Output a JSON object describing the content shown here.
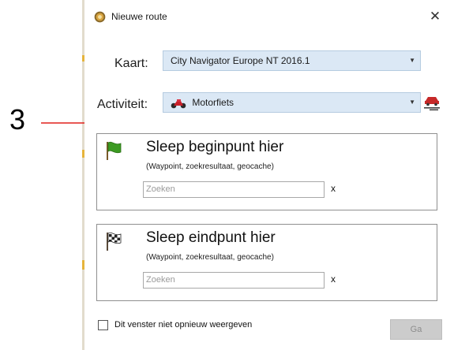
{
  "callout": {
    "number": "3",
    "arrow_color": "#e0201c"
  },
  "dialog": {
    "title": "Nieuwe route",
    "close_glyph": "✕",
    "map_label": "Kaart:",
    "map_value": "City Navigator Europe NT 2016.1",
    "activity_label": "Activiteit:",
    "activity_value": "Motorfiets",
    "start_panel": {
      "title": "Sleep beginpunt hier",
      "subtitle": "(Waypoint, zoekresultaat, geocache)",
      "search_placeholder": "Zoeken",
      "clear": "x",
      "icon": "green-flag-icon"
    },
    "end_panel": {
      "title": "Sleep eindpunt hier",
      "subtitle": "(Waypoint, zoekresultaat, geocache)",
      "search_placeholder": "Zoeken",
      "clear": "x",
      "icon": "checkered-flag-icon"
    },
    "checkbox_label": "Dit venster niet opnieuw weergeven",
    "checkbox_checked": false,
    "go_button": "Ga",
    "go_enabled": false
  },
  "colors": {
    "combo_bg": "#dbe8f5",
    "disabled_button": "#cccccc",
    "flag_green": "#3c9a22"
  }
}
